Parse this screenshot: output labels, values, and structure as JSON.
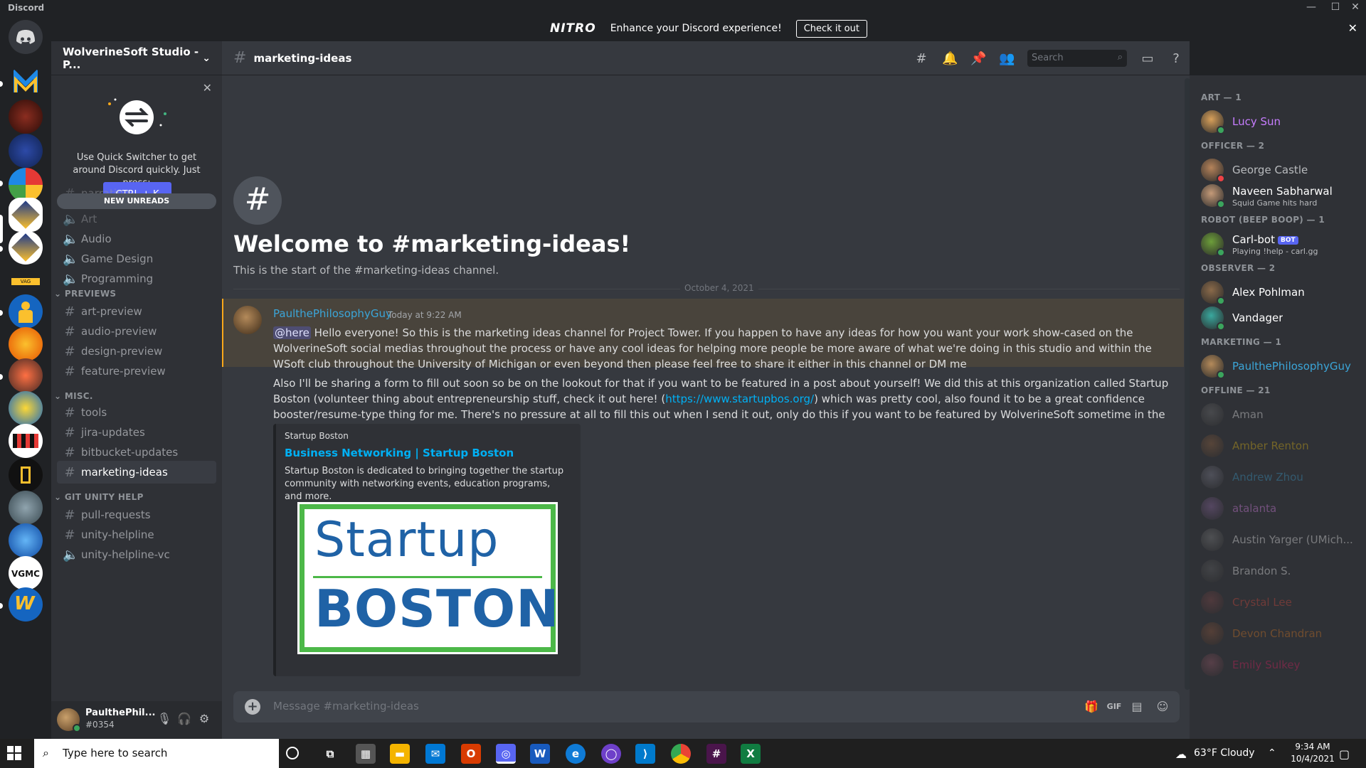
{
  "window": {
    "app_name": "Discord"
  },
  "nitro_banner": {
    "logo": "NITRO",
    "message": "Enhance your Discord experience!",
    "cta": "Check it out"
  },
  "guild": {
    "name": "WolverineSoft Studio - P..."
  },
  "quick_switcher": {
    "text": "Use Quick Switcher to get around Discord quickly. Just press:",
    "shortcut": "CTRL + K"
  },
  "new_unreads": "NEW UNREADS",
  "channels": {
    "partial_top": "narrative",
    "voice_top": [
      {
        "name": "Art"
      },
      {
        "name": "Audio"
      },
      {
        "name": "Game Design"
      },
      {
        "name": "Programming"
      }
    ],
    "previews_label": "PREVIEWS",
    "previews": [
      "art-preview",
      "audio-preview",
      "design-preview",
      "feature-preview"
    ],
    "misc_label": "MISC.",
    "misc": [
      "tools",
      "jira-updates",
      "bitbucket-updates",
      "marketing-ideas"
    ],
    "git_label": "GIT UNITY HELP",
    "git": [
      "pull-requests",
      "unity-helpline"
    ],
    "git_voice": "unity-helpline-vc"
  },
  "user": {
    "name": "PaulthePhil...",
    "tag": "#0354"
  },
  "channel": {
    "name": "marketing-ideas",
    "search_placeholder": "Search"
  },
  "welcome": {
    "title": "Welcome to #marketing-ideas!",
    "subtitle": "This is the start of the #marketing-ideas channel.",
    "date_divider": "October 4, 2021"
  },
  "message": {
    "author": "PaulthePhilosophyGuy",
    "time": "Today at 9:22 AM",
    "mention": "@here",
    "p1": "Hello everyone! So this is the marketing ideas channel for Project Tower. If you happen to have any ideas for how you want your work show-cased on the WolverineSoft social medias throughout the process or have any cool ideas for helping more people be more aware of what we're doing in this studio and within the WSoft club throughout the University of Michigan or even beyond then please feel free to share it either in this channel or DM me",
    "p2_a": "Also I'll be sharing a form to fill out soon so be on the lookout for that if you want to be featured in a post about yourself! We did this at this organization called Startup Boston (volunteer thing about entrepreneurship stuff, check it out here! (",
    "p2_link": "https://www.startupbos.org/",
    "p2_b": ") which was pretty cool, also found it to be a great confidence booster/resume-type thing for me. There's no pressure at all to fill this out when I send it out, only do this if you want to be featured by WolverineSoft sometime in the near future!"
  },
  "embed": {
    "provider": "Startup Boston",
    "title": "Business Networking | Startup Boston",
    "description": "Startup Boston is dedicated to bringing together the startup community with networking events, education programs, and more.",
    "image_word1": "Startup",
    "image_word2": "BOSTON"
  },
  "composer": {
    "placeholder": "Message #marketing-ideas"
  },
  "members": {
    "groups": [
      {
        "label": "ART — 1"
      },
      {
        "label": "OFFICER — 2"
      },
      {
        "label": "ROBOT (BEEP BOOP) — 1"
      },
      {
        "label": "OBSERVER — 2"
      },
      {
        "label": "MARKETING — 1"
      },
      {
        "label": "OFFLINE — 21"
      }
    ],
    "list": [
      {
        "name": "Lucy Sun",
        "color": "#c77dff",
        "status": "online"
      },
      {
        "name": "George Castle",
        "color": "#b9bbbe",
        "status": "dnd"
      },
      {
        "name": "Naveen Sabharwal",
        "color": "#ffffff",
        "activity": "Squid Game hits hard",
        "status": "online"
      },
      {
        "name": "Carl-bot",
        "badge": "BOT",
        "activity": "Playing !help - carl.gg",
        "color": "#ffffff",
        "status": "online"
      },
      {
        "name": "Alex Pohlman",
        "color": "#ffffff",
        "status": "online"
      },
      {
        "name": "Vandager",
        "color": "#ffffff",
        "status": "online"
      },
      {
        "name": "PaulthePhilosophyGuy",
        "color": "#3ba5d8",
        "status": "online"
      },
      {
        "name": "Aman",
        "color": "#ffffff"
      },
      {
        "name": "Amber Renton",
        "color": "#f1c40f"
      },
      {
        "name": "Andrew Zhou",
        "color": "#3ba5d8"
      },
      {
        "name": "atalanta",
        "color": "#f08cff"
      },
      {
        "name": "Austin Yarger (UMich...",
        "color": "#ffffff"
      },
      {
        "name": "Brandon S.",
        "color": "#ffffff"
      },
      {
        "name": "Crystal Lee",
        "color": "#e74c3c"
      },
      {
        "name": "Devon Chandran",
        "color": "#e67e22"
      },
      {
        "name": "Emily Sulkey",
        "color": "#e91e63"
      }
    ]
  },
  "taskbar": {
    "search_placeholder": "Type here to search",
    "weather": "63°F  Cloudy",
    "time": "9:34 AM",
    "date": "10/4/2021"
  }
}
